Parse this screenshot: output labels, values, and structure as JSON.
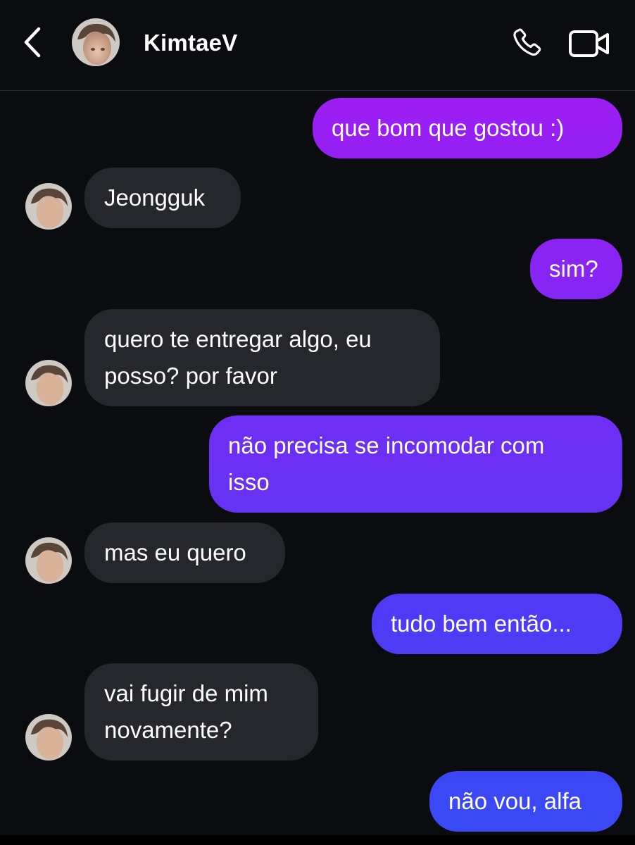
{
  "header": {
    "username": "KimtaeV"
  },
  "messages": [
    {
      "sender": "me",
      "text": "que bom que gostou :)"
    },
    {
      "sender": "them",
      "text": "Jeongguk"
    },
    {
      "sender": "me",
      "text": "sim?"
    },
    {
      "sender": "them",
      "line1": "quero te entregar algo, eu",
      "line2": "posso? por favor"
    },
    {
      "sender": "me",
      "line1": "não precisa se incomodar com",
      "line2": "isso"
    },
    {
      "sender": "them",
      "text": "mas eu quero"
    },
    {
      "sender": "me",
      "text": "tudo bem então..."
    },
    {
      "sender": "them",
      "line1": "vai fugir de mim",
      "line2": "novamente?"
    },
    {
      "sender": "me",
      "text": "não vou, alfa"
    }
  ],
  "icons": {
    "back": "chevron-left-icon",
    "call": "phone-icon",
    "video": "video-camera-icon"
  },
  "colors": {
    "background": "#0b0c10",
    "received_bubble": "#25272c",
    "sent_gradient_top": "#9b1ff2",
    "sent_gradient_bottom": "#3b4df5"
  }
}
